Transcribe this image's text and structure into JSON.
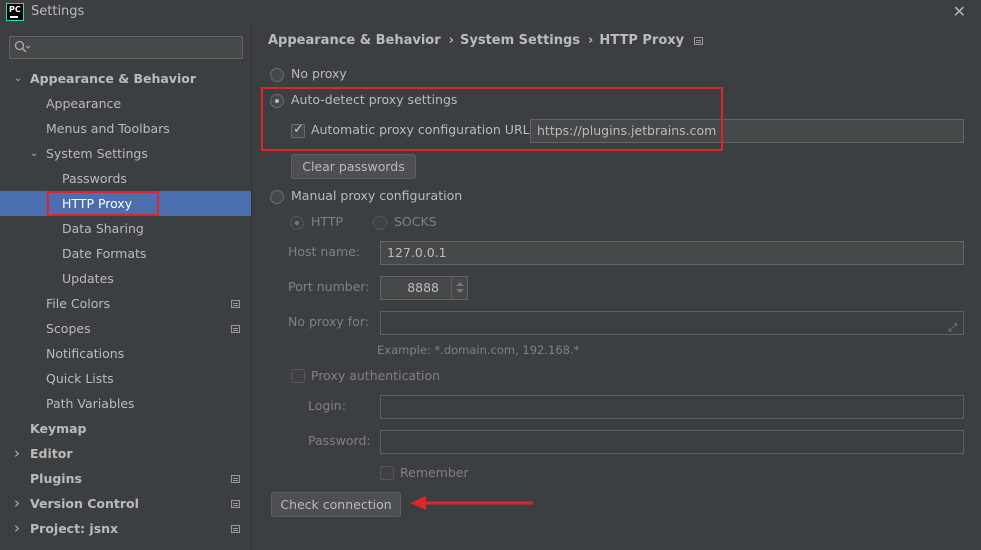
{
  "window": {
    "title": "Settings",
    "app_icon": "PC"
  },
  "search": {
    "placeholder": ""
  },
  "sidebar": {
    "items": [
      {
        "label": "Appearance & Behavior",
        "level": 0,
        "bold": true,
        "expanded": true
      },
      {
        "label": "Appearance",
        "level": 1
      },
      {
        "label": "Menus and Toolbars",
        "level": 1
      },
      {
        "label": "System Settings",
        "level": 1,
        "expanded": true
      },
      {
        "label": "Passwords",
        "level": 2
      },
      {
        "label": "HTTP Proxy",
        "level": 2,
        "selected": true
      },
      {
        "label": "Data Sharing",
        "level": 2
      },
      {
        "label": "Date Formats",
        "level": 2
      },
      {
        "label": "Updates",
        "level": 2
      },
      {
        "label": "File Colors",
        "level": 1,
        "project_icon": true
      },
      {
        "label": "Scopes",
        "level": 1,
        "project_icon": true
      },
      {
        "label": "Notifications",
        "level": 1
      },
      {
        "label": "Quick Lists",
        "level": 1
      },
      {
        "label": "Path Variables",
        "level": 1
      },
      {
        "label": "Keymap",
        "level": 0,
        "bold": true
      },
      {
        "label": "Editor",
        "level": 0,
        "bold": true,
        "collapsed": true
      },
      {
        "label": "Plugins",
        "level": 0,
        "bold": true,
        "project_icon": true
      },
      {
        "label": "Version Control",
        "level": 0,
        "bold": true,
        "collapsed": true,
        "project_icon": true
      },
      {
        "label": "Project: jsnx",
        "level": 0,
        "bold": true,
        "collapsed": true,
        "project_icon": true
      }
    ]
  },
  "breadcrumb": {
    "items": [
      "Appearance & Behavior",
      "System Settings",
      "HTTP Proxy"
    ],
    "separator": "›"
  },
  "proxy": {
    "no_proxy_label": "No proxy",
    "auto_detect_label": "Auto-detect proxy settings",
    "auto_config_url_label": "Automatic proxy configuration URL:",
    "auto_config_url_value": "https://plugins.jetbrains.com",
    "clear_passwords_label": "Clear passwords",
    "manual_label": "Manual proxy configuration",
    "http_label": "HTTP",
    "socks_label": "SOCKS",
    "host_name_label": "Host name:",
    "host_name_value": "127.0.0.1",
    "port_number_label": "Port number:",
    "port_number_value": "8888",
    "no_proxy_for_label": "No proxy for:",
    "no_proxy_for_value": "",
    "example_text": "Example: *.domain.com, 192.168.*",
    "proxy_auth_label": "Proxy authentication",
    "login_label": "Login:",
    "login_value": "",
    "password_label": "Password:",
    "password_value": "",
    "remember_label": "Remember",
    "check_connection_label": "Check connection",
    "selected_mode": "auto-detect",
    "auto_config_url_checked": true,
    "manual_protocol": "HTTP"
  },
  "colors": {
    "background": "#3c3f41",
    "selection": "#4b6eaf",
    "annotation_red": "#e0242c",
    "text": "#bbbbbb",
    "disabled_text": "#808080"
  }
}
